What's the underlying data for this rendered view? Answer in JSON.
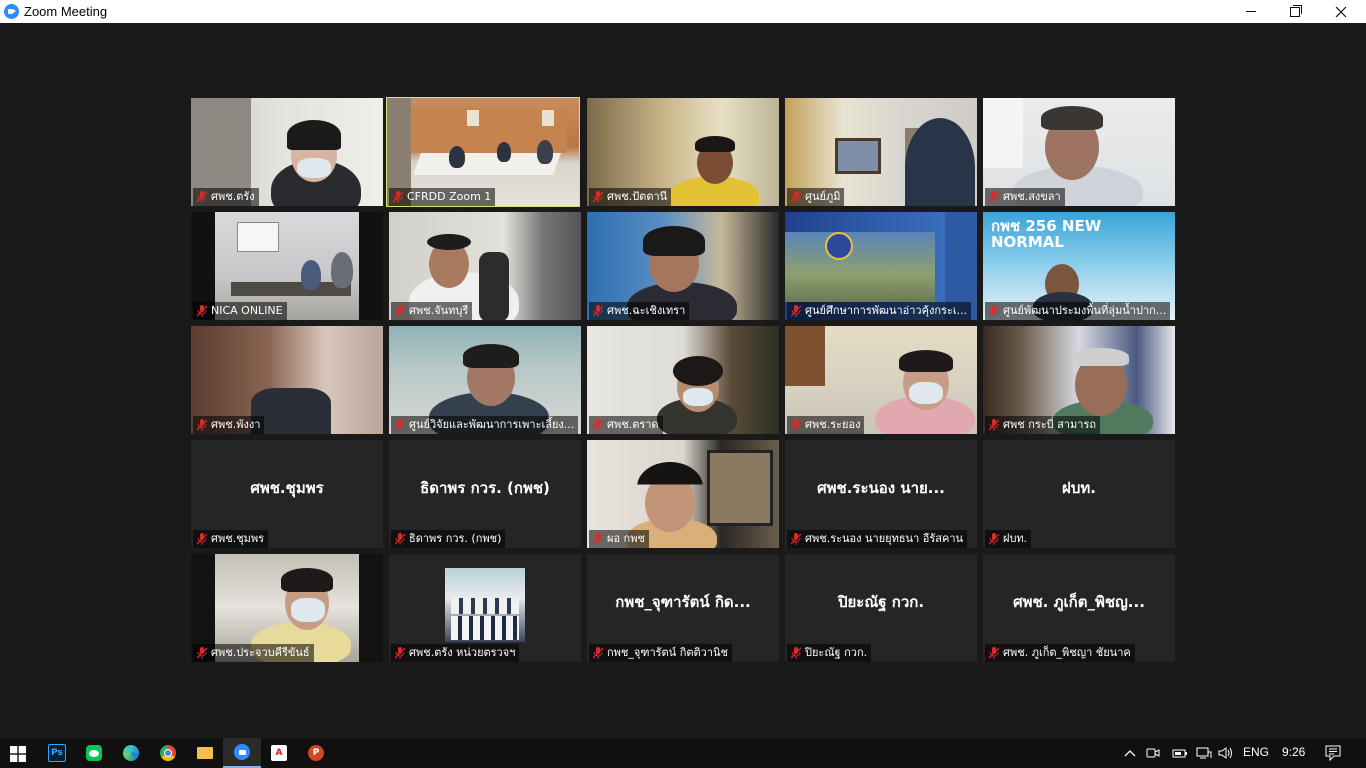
{
  "window": {
    "title": "Zoom Meeting"
  },
  "participants": [
    {
      "name": "ศพช.ตรัง",
      "video": true
    },
    {
      "name": "CFRDD Zoom 1",
      "video": true,
      "active_speaker": true
    },
    {
      "name": "ศพช.ปัตตานี",
      "video": true
    },
    {
      "name": "ศูนย์ภูมิ",
      "video": true
    },
    {
      "name": "ศพช.สงขลา",
      "video": true
    },
    {
      "name": "NICA ONLINE",
      "video": true
    },
    {
      "name": "ศพช.จันทบุรี",
      "video": true
    },
    {
      "name": "ศพช.ฉะเชิงเทรา",
      "video": true
    },
    {
      "name": "ศูนย์ศึกษาการพัฒนาอ่าวคุ้งกระเ...",
      "video": true
    },
    {
      "name": "ศูนย์พัฒนาประมงพื้นที่ลุ่มน้ำปาก...",
      "video": true,
      "banner": "กพช 256 NEW NORMAL"
    },
    {
      "name": "ศพช.พังงา",
      "video": true
    },
    {
      "name": "ศูนย์วิจัยและพัฒนาการเพาะเลี้ยง...",
      "video": true
    },
    {
      "name": "ศพช.ตราด",
      "video": true
    },
    {
      "name": "ศพช.ระยอง",
      "video": true
    },
    {
      "name": "ศพช กระบี่ สามารถ",
      "video": true
    },
    {
      "name": "ศพช.ชุมพร",
      "video": false,
      "display": "ศพช.ชุมพร"
    },
    {
      "name": "ธิดาพร กวร. (กพช)",
      "video": false,
      "display": "ธิดาพร กวร. (กพช)"
    },
    {
      "name": "ผอ กพช",
      "video": true
    },
    {
      "name": "ศพช.ระนอง นายยุทธนา อีรัสคาน",
      "video": false,
      "display": "ศพช.ระนอง นาย..."
    },
    {
      "name": "ฝบท.",
      "video": false,
      "display": "ฝบท."
    },
    {
      "name": "ศพช.ประจวบคีรีขันธ์",
      "video": true
    },
    {
      "name": "ศพช.ตรัง หน่วยตรวจฯ",
      "video": true
    },
    {
      "name": "กพช_จุฑารัตน์ กิตติวานิช",
      "video": false,
      "display": "กพช_จุฑารัตน์ กิด..."
    },
    {
      "name": "ปิยะณัฐ กวก.",
      "video": false,
      "display": "ปิยะณัฐ กวก."
    },
    {
      "name": "ศพช. ภูเก็ต_พิชญา ชัยนาค",
      "video": false,
      "display": "ศพช. ภูเก็ต_พิชญ..."
    }
  ],
  "taskbar": {
    "apps": [
      "Photoshop",
      "LINE",
      "Edge",
      "Chrome",
      "File Explorer",
      "Zoom",
      "Acrobat",
      "PowerPoint"
    ],
    "language": "ENG",
    "time": "9:26"
  },
  "colors": {
    "active_outline": "#d6e46f",
    "mic_off": "#e02828"
  }
}
